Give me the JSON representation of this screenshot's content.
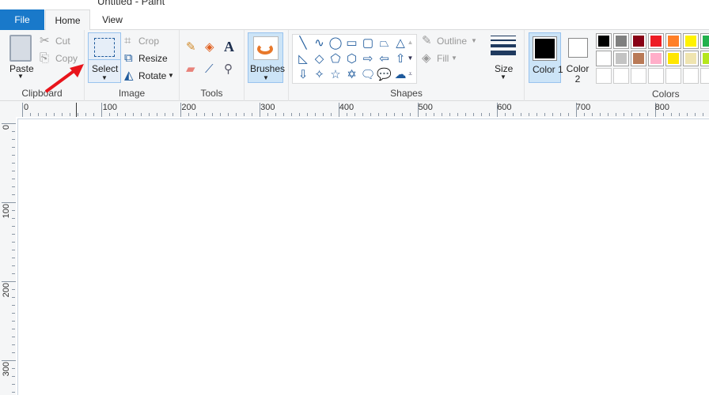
{
  "window": {
    "title": "Untitled - Paint"
  },
  "tabs": [
    {
      "label": "File"
    },
    {
      "label": "Home"
    },
    {
      "label": "View"
    }
  ],
  "clipboard": {
    "paste": "Paste",
    "cut": "Cut",
    "copy": "Copy",
    "group": "Clipboard"
  },
  "image": {
    "select": "Select",
    "crop": "Crop",
    "resize": "Resize",
    "rotate": "Rotate",
    "group": "Image"
  },
  "tools": {
    "group": "Tools",
    "items": [
      "pencil-icon",
      "fill-bucket-icon",
      "text-icon",
      "eraser-icon",
      "color-picker-icon",
      "magnifier-icon"
    ]
  },
  "brushes": {
    "label": "Brushes"
  },
  "shapes": {
    "group": "Shapes",
    "outline": "Outline",
    "fill": "Fill",
    "glyphs": [
      "╲",
      "∿",
      "◯",
      "▭",
      "▢",
      "⏢",
      "△",
      "◺",
      "◇",
      "⬠",
      "⬡",
      "⇨",
      "⇦",
      "⇧",
      "⇩",
      "✧",
      "☆",
      "✡",
      "🗨",
      "💬",
      "☁"
    ]
  },
  "size": {
    "label": "Size"
  },
  "colors": {
    "color1": "Color 1",
    "color2": "Color 2",
    "group": "Colors",
    "color1_value": "#000000",
    "color2_value": "#ffffff",
    "palette_row1": [
      "#000000",
      "#7f7f7f",
      "#880015",
      "#ed1c24",
      "#ff7f27",
      "#fff200",
      "#22b14c"
    ],
    "palette_row2": [
      "#ffffff",
      "#c3c3c3",
      "#b97a57",
      "#ffaec9",
      "#ffe600",
      "#efe4b0",
      "#b5e61d"
    ]
  },
  "ruler": {
    "h": [
      "0",
      "100",
      "200",
      "300",
      "400",
      "500",
      "600",
      "700",
      "800"
    ],
    "v": [
      "0",
      "100",
      "200",
      "300"
    ]
  }
}
